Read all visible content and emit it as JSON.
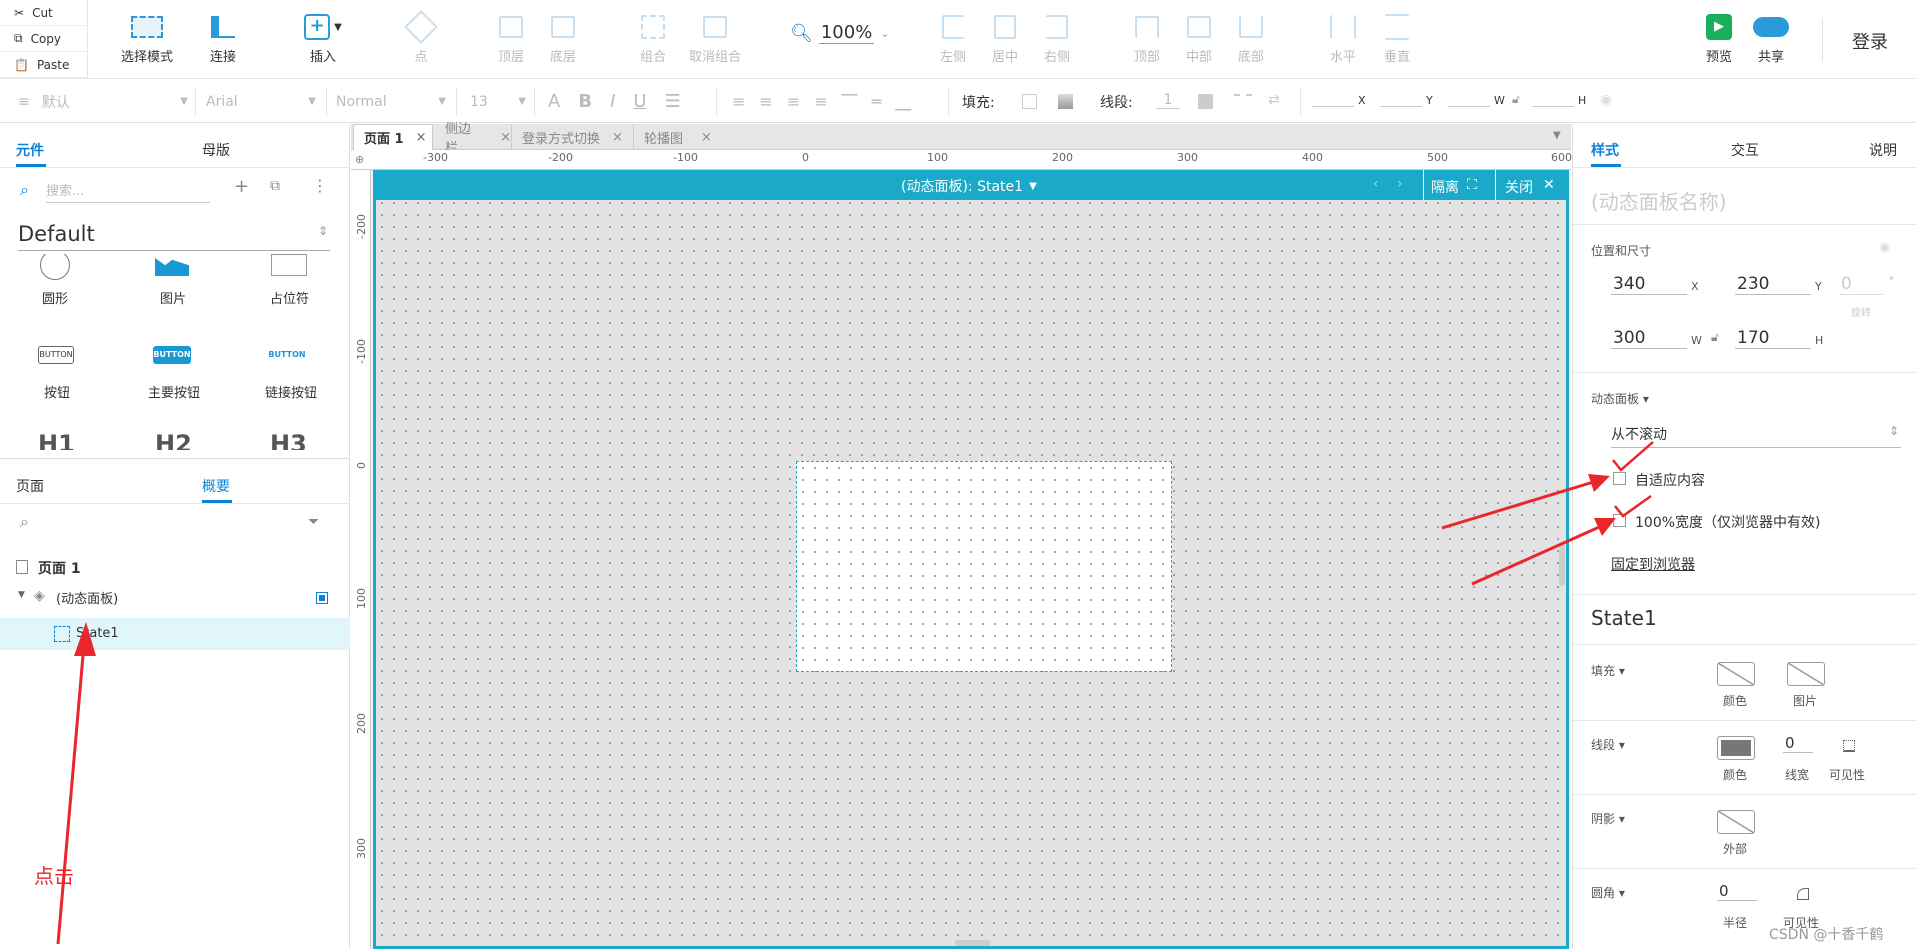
{
  "toolbar": {
    "clipboard": [
      {
        "icon": "scissors-icon",
        "label": "Cut"
      },
      {
        "icon": "copy-icon",
        "label": "Copy"
      },
      {
        "icon": "paste-icon",
        "label": "Paste"
      }
    ],
    "select_mode": "选择模式",
    "connect": "连接",
    "insert": "插入",
    "point": "点",
    "top_layer": "顶层",
    "bottom_layer": "底层",
    "group": "组合",
    "ungroup": "取消组合",
    "zoom": "100%",
    "align_left": "左侧",
    "align_center": "居中",
    "align_right": "右侧",
    "align_top": "顶部",
    "align_middle": "中部",
    "align_bottom": "底部",
    "dist_h": "水平",
    "dist_v": "垂直",
    "preview": "预览",
    "share": "共享",
    "login": "登录"
  },
  "format_bar": {
    "style": "默认",
    "font": "Arial",
    "weight": "Normal",
    "size": "13",
    "fill_label": "填充:",
    "stroke_label": "线段:",
    "stroke_value": "1",
    "x_label": "X",
    "y_label": "Y",
    "w_label": "W",
    "h_label": "H"
  },
  "left_panel": {
    "tabs": [
      "元件",
      "母版"
    ],
    "search_placeholder": "搜索...",
    "library": "Default",
    "widgets": [
      {
        "label": "圆形",
        "icon": "circle-icon"
      },
      {
        "label": "图片",
        "icon": "image-icon"
      },
      {
        "label": "占位符",
        "icon": "placeholder-icon"
      },
      {
        "label": "按钮",
        "icon": "button-icon",
        "text": "BUTTON"
      },
      {
        "label": "主要按钮",
        "icon": "primary-button-icon",
        "text": "BUTTON"
      },
      {
        "label": "链接按钮",
        "icon": "link-button-icon",
        "text": "BUTTON"
      },
      {
        "label": "H1"
      },
      {
        "label": "H2"
      },
      {
        "label": "H3"
      }
    ],
    "outline_tabs": [
      "页面",
      "概要"
    ],
    "tree": {
      "page": "页面 1",
      "panel": "(动态面板)",
      "state": "State1"
    },
    "annotation": "点击"
  },
  "canvas": {
    "tabs": [
      {
        "label": "页面 1",
        "active": true
      },
      {
        "label": "侧边栏",
        "active": false
      },
      {
        "label": "登录方式切换",
        "active": false
      },
      {
        "label": "轮播图",
        "active": false
      }
    ],
    "ruler_h": [
      "-300",
      "-200",
      "-100",
      "0",
      "100",
      "200",
      "300",
      "400",
      "500",
      "600"
    ],
    "ruler_v": [
      "-200",
      "-100",
      "0",
      "100",
      "200",
      "300"
    ],
    "panel_title": "(动态面板): State1",
    "isolate": "隔离",
    "close": "关闭"
  },
  "right_panel": {
    "tabs": [
      "样式",
      "交互",
      "说明"
    ],
    "name_placeholder": "(动态面板名称)",
    "pos_size": "位置和尺寸",
    "x": "340",
    "y": "230",
    "rotate": "0",
    "rotate_label": "旋转",
    "w": "300",
    "h": "170",
    "panel_section": "动态面板",
    "scroll": "从不滚动",
    "fit_content": "自适应内容",
    "full_width": "100%宽度（仅浏览器中有效)",
    "pin": "固定到浏览器",
    "state_name": "State1",
    "fill": "填充",
    "fill_color": "颜色",
    "fill_image": "图片",
    "stroke": "线段",
    "stroke_color": "颜色",
    "stroke_width": "0",
    "stroke_width_label": "线宽",
    "visibility": "可见性",
    "shadow": "阴影",
    "shadow_outer": "外部",
    "radius": "圆角",
    "radius_value": "0",
    "radius_label": "半径",
    "radius_vis": "可见性"
  },
  "watermark": "CSDN @十香千鹤",
  "colors": {
    "accent": "#1aa9c8",
    "blue": "#0b84d8",
    "red": "#e8262c"
  }
}
